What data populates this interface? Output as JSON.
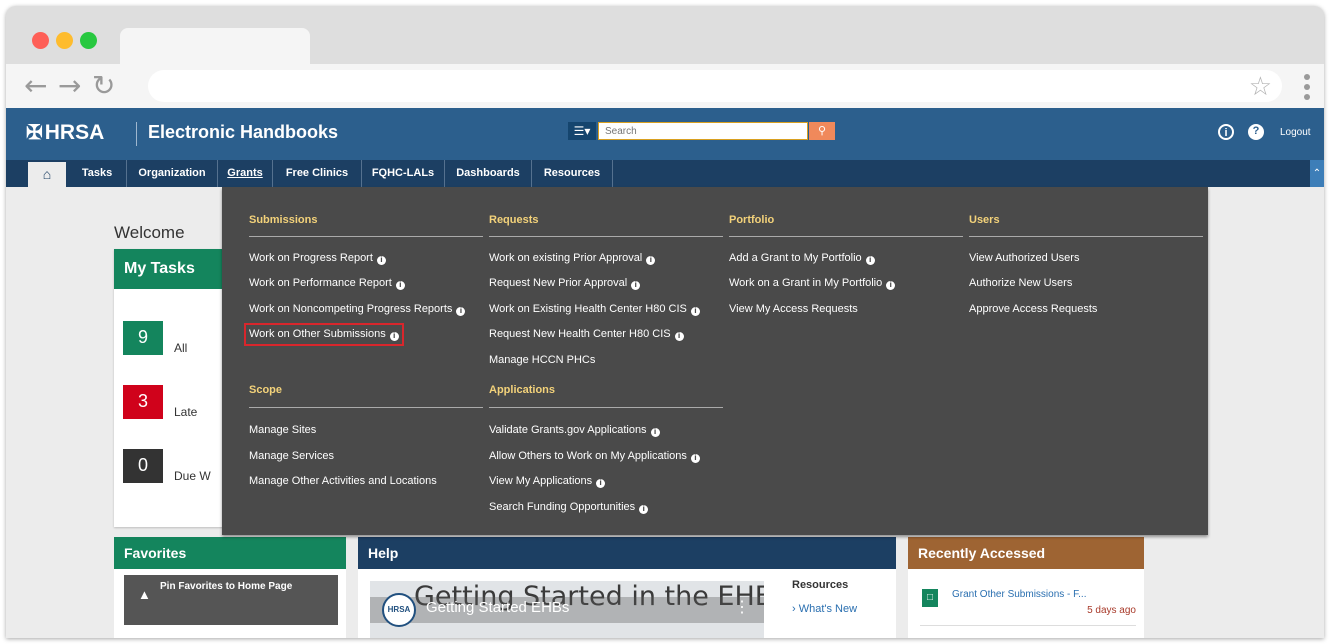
{
  "colors": {
    "accent_dark": "#1c3f63",
    "topbar": "#2c5f8d",
    "green": "#14855d",
    "red": "#d0021b",
    "brown": "#9e6433",
    "menu_heading": "#f3d27a",
    "highlight_red": "#d9262c"
  },
  "header": {
    "logo_text": "HRSA",
    "app_title": "Electronic Handbooks",
    "search_placeholder": "Search",
    "logout_label": "Logout"
  },
  "nav": {
    "items": [
      "Tasks",
      "Organization",
      "Grants",
      "Free Clinics",
      "FQHC-LALs",
      "Dashboards",
      "Resources"
    ],
    "active": "Grants"
  },
  "welcome": "Welcome",
  "my_tasks": {
    "title": "My Tasks",
    "counts": [
      {
        "value": "9",
        "label": "All",
        "color": "#14855d"
      },
      {
        "value": "3",
        "label": "Late",
        "color": "#d0021b"
      },
      {
        "value": "0",
        "label": "Due W",
        "color": "#333333"
      }
    ]
  },
  "mega_menu": {
    "submissions": {
      "title": "Submissions",
      "links": [
        {
          "label": "Work on Progress Report",
          "info": true
        },
        {
          "label": "Work on Performance Report",
          "info": true
        },
        {
          "label": "Work on Noncompeting Progress Reports",
          "info": true
        },
        {
          "label": "Work on Other Submissions",
          "info": true,
          "highlighted": true
        }
      ]
    },
    "scope": {
      "title": "Scope",
      "links": [
        {
          "label": "Manage Sites",
          "info": false
        },
        {
          "label": "Manage Services",
          "info": false
        },
        {
          "label": "Manage Other Activities and Locations",
          "info": false
        }
      ]
    },
    "requests": {
      "title": "Requests",
      "links": [
        {
          "label": "Work on existing Prior Approval",
          "info": true
        },
        {
          "label": "Request New Prior Approval",
          "info": true
        },
        {
          "label": "Work on Existing Health Center H80 CIS",
          "info": true
        },
        {
          "label": "Request New Health Center H80 CIS",
          "info": true
        },
        {
          "label": "Manage HCCN PHCs",
          "info": false
        }
      ]
    },
    "applications": {
      "title": "Applications",
      "links": [
        {
          "label": "Validate Grants.gov Applications",
          "info": true
        },
        {
          "label": "Allow Others to Work on My Applications",
          "info": true
        },
        {
          "label": "View My Applications",
          "info": true
        },
        {
          "label": "Search Funding Opportunities",
          "info": true
        }
      ]
    },
    "portfolio": {
      "title": "Portfolio",
      "links": [
        {
          "label": "Add a Grant to My Portfolio",
          "info": true
        },
        {
          "label": "Work on a Grant in My Portfolio",
          "info": true
        },
        {
          "label": "View My Access Requests",
          "info": false
        }
      ]
    },
    "users": {
      "title": "Users",
      "links": [
        {
          "label": "View Authorized Users",
          "info": false
        },
        {
          "label": "Authorize New Users",
          "info": false
        },
        {
          "label": "Approve Access Requests",
          "info": false
        }
      ]
    }
  },
  "favorites": {
    "title": "Favorites",
    "pin_label": "Pin Favorites to Home Page"
  },
  "help": {
    "title": "Help",
    "video_overlay_text": "Getting Started in the EHBs!",
    "video_logo": "HRSA",
    "video_title": "Getting Started EHBs",
    "resources_heading": "Resources",
    "whats_new": "› What's New"
  },
  "recent": {
    "title": "Recently Accessed",
    "item_name": "Grant Other Submissions - F...",
    "item_time": "5 days ago"
  }
}
